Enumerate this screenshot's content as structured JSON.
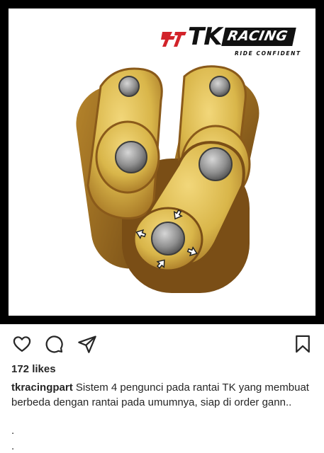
{
  "post_image": {
    "brand": {
      "emblem_text": "卝",
      "name_primary": "TK",
      "name_secondary": "RACING",
      "tagline": "RIDE CONFIDENT"
    },
    "colors": {
      "frame": "#000000",
      "chain_gold": "#d9b64a",
      "chain_shadow": "#8a5a1a",
      "pin_steel": "#9a9a9a",
      "background": "#ffffff"
    }
  },
  "actions": {
    "like_icon": "heart-icon",
    "comment_icon": "comment-icon",
    "share_icon": "paper-plane-icon",
    "save_icon": "bookmark-icon"
  },
  "post": {
    "likes": "172 likes",
    "username": "tkracingpart",
    "caption": "Sistem 4 pengunci pada rantai TK yang membuat berbeda dengan rantai pada umumnya, siap di order gann..",
    "extra_lines": [
      ".",
      "."
    ]
  }
}
